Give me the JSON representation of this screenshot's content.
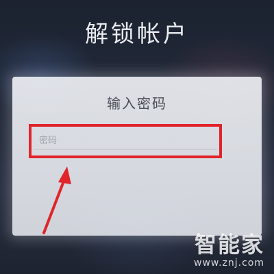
{
  "header": {
    "title": "解锁帐户"
  },
  "dialog": {
    "title": "输入密码",
    "password_input": {
      "placeholder": "密码",
      "value": ""
    }
  },
  "annotations": {
    "highlight_color": "#e0242a",
    "arrow_color": "#e0242a"
  },
  "watermark": {
    "brand": "智能家",
    "url": "www.znj.com"
  }
}
